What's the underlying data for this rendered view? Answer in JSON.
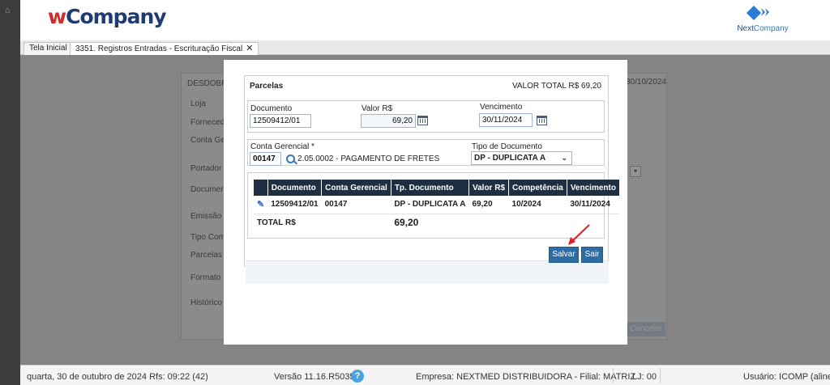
{
  "header": {
    "logo_prefix": "w",
    "logo_rest": "Company",
    "brand_logo": {
      "part1": "Next",
      "part2": "Company"
    }
  },
  "tabs": [
    {
      "label": "Tela Inicial"
    },
    {
      "label": "3351. Registros Entradas - Escrituração Fiscal"
    }
  ],
  "background": {
    "title": "DESDOBRA",
    "date": "30/10/2024",
    "labels": [
      "Loja",
      "Forneced",
      "Conta Ge",
      "Portador",
      "Document",
      "Emissão",
      "Tipo Com",
      "Parcelas",
      "Formato",
      "Histórico"
    ],
    "cancel_label": "Cancelar"
  },
  "modal": {
    "title": "Parcelas",
    "valor_total": "VALOR TOTAL R$ 69,20",
    "documento_label": "Documento",
    "documento_value": "12509412/01",
    "valor_label": "Valor R$",
    "valor_value": "69,20",
    "vencimento_label": "Vencimento",
    "vencimento_value": "30/11/2024",
    "conta_label": "Conta Gerencial *",
    "conta_code": "00147",
    "conta_desc": "2.05.0002 - PAGAMENTO DE FRETES",
    "tipo_label": "Tipo de Documento",
    "tipo_value": "DP - DUPLICATA A",
    "grid": {
      "headers": [
        "Documento",
        "Conta Gerencial",
        "Tp. Documento",
        "Valor R$",
        "Competência",
        "Vencimento"
      ],
      "rows": [
        {
          "documento": "12509412/01",
          "conta": "00147",
          "tipo": "DP - DUPLICATA A",
          "valor": "69,20",
          "competencia": "10/2024",
          "vencimento": "30/11/2024"
        }
      ],
      "total_label": "TOTAL R$",
      "total_value": "69,20"
    },
    "salvar_label": "Salvar",
    "sair_label": "Sair"
  },
  "status": {
    "datetime": "quarta, 30 de outubro de 2024  Rfs: 09:22 (42)",
    "version": "Versão 11.16.R5035",
    "help": "?",
    "empresa": "Empresa: NEXTMED DISTRIBUIDORA - Filial: MATRIZ",
    "lj": "LJ: 00",
    "usuario": "Usuário: ICOMP (aline)"
  },
  "colors": {
    "header_navy": "#1e2f44",
    "button_blue": "#2e6da4",
    "logo_red": "#d42a2a",
    "arrow_red": "#e02020"
  }
}
